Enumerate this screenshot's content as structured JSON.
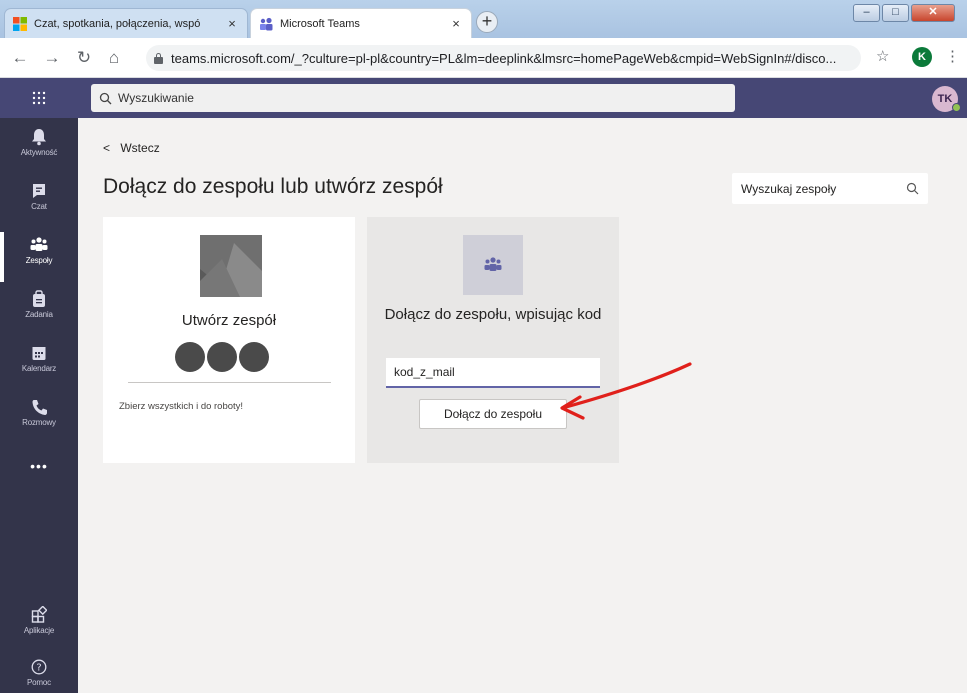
{
  "browser": {
    "tabs": [
      {
        "label": "Czat, spotkania, połączenia, wspó",
        "close": "×"
      },
      {
        "label": "Microsoft Teams",
        "close": "×"
      }
    ],
    "new_tab": "+",
    "url": "teams.microsoft.com/_?culture=pl-pl&country=PL&lm=deeplink&lmsrc=homePageWeb&cmpid=WebSignIn#/disco...",
    "profile_initial": "K",
    "window_buttons": {
      "minimize": "‒",
      "maximize": "□",
      "close": "✕"
    }
  },
  "teams_header": {
    "search_placeholder": "Wyszukiwanie",
    "avatar_initials": "TK"
  },
  "rail": {
    "items": [
      {
        "label": "Aktywność"
      },
      {
        "label": "Czat"
      },
      {
        "label": "Zespoły"
      },
      {
        "label": "Zadania"
      },
      {
        "label": "Kalendarz"
      },
      {
        "label": "Rozmowy"
      }
    ],
    "more": "•••",
    "bottom": [
      {
        "label": "Aplikacje"
      },
      {
        "label": "Pomoc"
      }
    ]
  },
  "main": {
    "back_label": "Wstecz",
    "title": "Dołącz do zespołu lub utwórz zespół",
    "team_search_placeholder": "Wyszukaj zespoły",
    "create_card": {
      "title": "Utwórz zespół",
      "description": "Zbierz wszystkich i do roboty!"
    },
    "join_card": {
      "title": "Dołącz do zespołu, wpisując kod",
      "code_value": "kod_z_mail",
      "button_label": "Dołącz do zespołu"
    }
  },
  "colors": {
    "teams_purple": "#464775",
    "rail": "#33344a",
    "accent": "#6264a7",
    "annotation_arrow": "#e0201b"
  }
}
